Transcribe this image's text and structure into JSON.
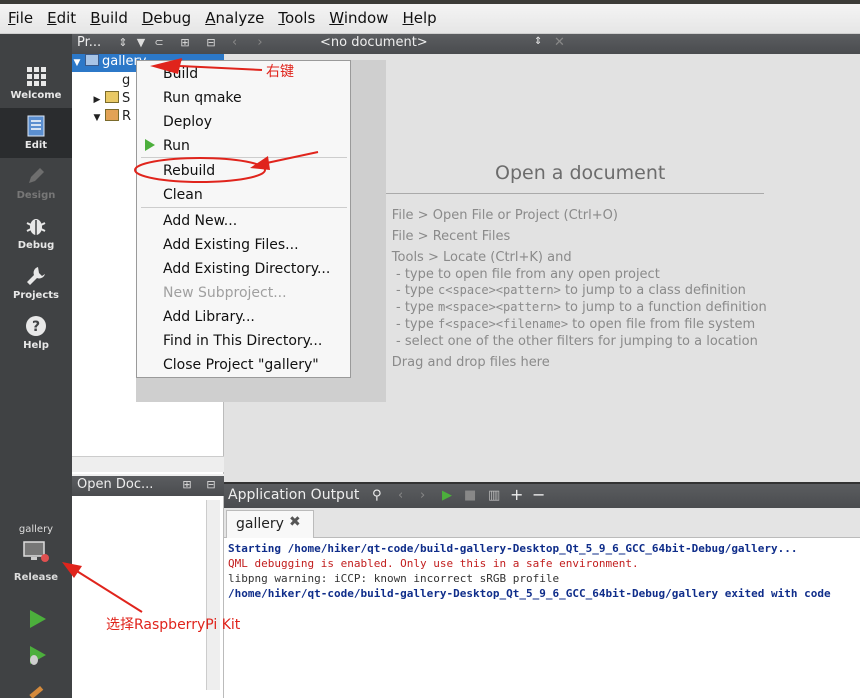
{
  "menubar": {
    "items": [
      {
        "accel": "F",
        "rest": "ile"
      },
      {
        "accel": "E",
        "rest": "dit"
      },
      {
        "accel": "B",
        "rest": "uild"
      },
      {
        "accel": "D",
        "rest": "ebug"
      },
      {
        "accel": "A",
        "rest": "nalyze"
      },
      {
        "accel": "T",
        "rest": "ools"
      },
      {
        "accel": "W",
        "rest": "indow"
      },
      {
        "accel": "H",
        "rest": "elp"
      }
    ]
  },
  "modes": {
    "welcome": "Welcome",
    "edit": "Edit",
    "design": "Design",
    "debug": "Debug",
    "projects": "Projects",
    "help": "Help"
  },
  "kit": {
    "project": "gallery",
    "build_mode": "Release"
  },
  "projects_pane": {
    "title": "Pr...",
    "tree": [
      {
        "label": "gallery"
      },
      {
        "label": "g"
      },
      {
        "label": "S"
      },
      {
        "label": "R"
      }
    ]
  },
  "open_docs": {
    "title": "Open Doc..."
  },
  "editor": {
    "doc_selector": "<no document>",
    "open_title": "Open a document",
    "hints": [
      "• File > Open File or Project (Ctrl+O)",
      "• File > Recent Files",
      "• Tools > Locate (Ctrl+K) and"
    ],
    "locate_items": [
      {
        "pre": "- type to open file from any open project",
        "code": "",
        "post": ""
      },
      {
        "pre": "- type ",
        "code": "c<space><pattern>",
        "post": " to jump to a class definition"
      },
      {
        "pre": "- type ",
        "code": "m<space><pattern>",
        "post": " to jump to a function definition"
      },
      {
        "pre": "- type ",
        "code": "f<space><filename>",
        "post": " to open file from file system"
      },
      {
        "pre": "- select one of the other filters for jumping to a location",
        "code": "",
        "post": ""
      }
    ],
    "drag_hint": "• Drag and drop files here"
  },
  "context_menu": {
    "items": {
      "build": "Build",
      "run_qmake": "Run qmake",
      "deploy": "Deploy",
      "run": "Run",
      "rebuild": "Rebuild",
      "clean": "Clean",
      "add_new": "Add New...",
      "add_existing_files": "Add Existing Files...",
      "add_existing_directory": "Add Existing Directory...",
      "new_subproject": "New Subproject...",
      "add_library": "Add Library...",
      "find_in_directory": "Find in This Directory...",
      "close_project": "Close Project \"gallery\""
    }
  },
  "output": {
    "title": "Application Output",
    "tab": "gallery",
    "lines": [
      "Starting /home/hiker/qt-code/build-gallery-Desktop_Qt_5_9_6_GCC_64bit-Debug/gallery...",
      "QML debugging is enabled. Only use this in a safe environment.",
      "libpng warning: iCCP: known incorrect sRGB profile",
      "/home/hiker/qt-code/build-gallery-Desktop_Qt_5_9_6_GCC_64bit-Debug/gallery exited with code"
    ]
  },
  "annotations": {
    "right_click": "右键",
    "select_kit": "选择RaspberryPi Kit"
  },
  "colors": {
    "mode_bar": "#404244",
    "selection": "#2c78c8",
    "annotation": "#e0241c",
    "run_green": "#4caf3c"
  }
}
